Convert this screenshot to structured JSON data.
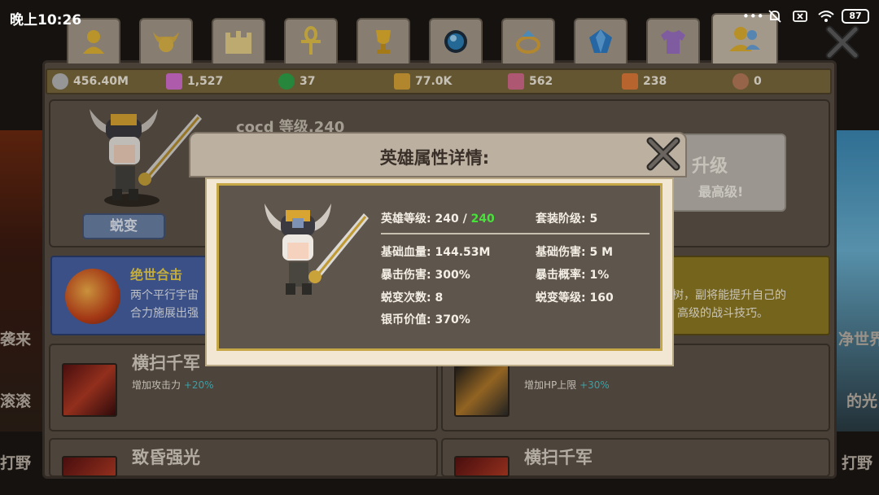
{
  "status_bar": {
    "time": "晚上10:26",
    "battery": "87"
  },
  "tabs": [
    {
      "icon": "hero-bust-icon"
    },
    {
      "icon": "horned-helmet-icon"
    },
    {
      "icon": "castle-icon"
    },
    {
      "icon": "ankh-icon"
    },
    {
      "icon": "trophy-icon"
    },
    {
      "icon": "dark-orb-icon"
    },
    {
      "icon": "ring-icon"
    },
    {
      "icon": "gem-icon"
    },
    {
      "icon": "shirt-icon"
    },
    {
      "icon": "heroes-icon"
    }
  ],
  "resources": [
    {
      "icon": "silver-coin-icon",
      "value": "456.40M",
      "color": "#b8b8b8"
    },
    {
      "icon": "pink-crystal-icon",
      "value": "1,527",
      "color": "#d36fd0"
    },
    {
      "icon": "green-orb-icon",
      "value": "37",
      "color": "#2fa44a"
    },
    {
      "icon": "gold-shard-icon",
      "value": "77.0K",
      "color": "#d8a437"
    },
    {
      "icon": "red-shard-icon",
      "value": "562",
      "color": "#d46b8d"
    },
    {
      "icon": "orange-shard-icon",
      "value": "238",
      "color": "#e07a3a"
    },
    {
      "icon": "medal-icon",
      "value": "0",
      "color": "#b87a5a"
    }
  ],
  "hero_card": {
    "name_level": "cocd 等级.240",
    "transform_button": "蜕变",
    "upgrade_title": "升级",
    "upgrade_status": "最高级!"
  },
  "banners": {
    "left_title": "绝世合击",
    "left_desc_1": "两个平行宇宙",
    "left_desc_2": "合力施展出强",
    "right_desc_1": "树，副将能提升自己的",
    "right_desc_2": "高级的战斗技巧。"
  },
  "skills": [
    {
      "title": "横扫千军",
      "desc": "增加攻击力",
      "bonus": "+20%"
    },
    {
      "title": "",
      "desc": "增加HP上限",
      "bonus": "+30%"
    },
    {
      "title": "致昏强光",
      "desc": "",
      "bonus": ""
    },
    {
      "title": "横扫千军",
      "desc": "",
      "bonus": ""
    }
  ],
  "side_labels": {
    "left": [
      "袭来",
      "滚滚",
      "打野"
    ],
    "right": [
      "净世界",
      "的光",
      "打野"
    ]
  },
  "dialog": {
    "title": "英雄属性详情:",
    "hero_level_label": "英雄等级:",
    "hero_level_value": "240 /",
    "hero_level_max": "240",
    "set_tier_label": "套装阶级:",
    "set_tier_value": "5",
    "base_hp_label": "基础血量:",
    "base_hp_value": "144.53M",
    "base_damage_label": "基础伤害:",
    "base_damage_value": "5 M",
    "crit_damage_label": "暴击伤害:",
    "crit_damage_value": "300%",
    "crit_rate_label": "暴击概率:",
    "crit_rate_value": "1%",
    "transform_count_label": "蜕变次数:",
    "transform_count_value": "8",
    "transform_level_label": "蜕变等级:",
    "transform_level_value": "160",
    "coin_value_label": "银币价值:",
    "coin_value_value": "370%"
  }
}
